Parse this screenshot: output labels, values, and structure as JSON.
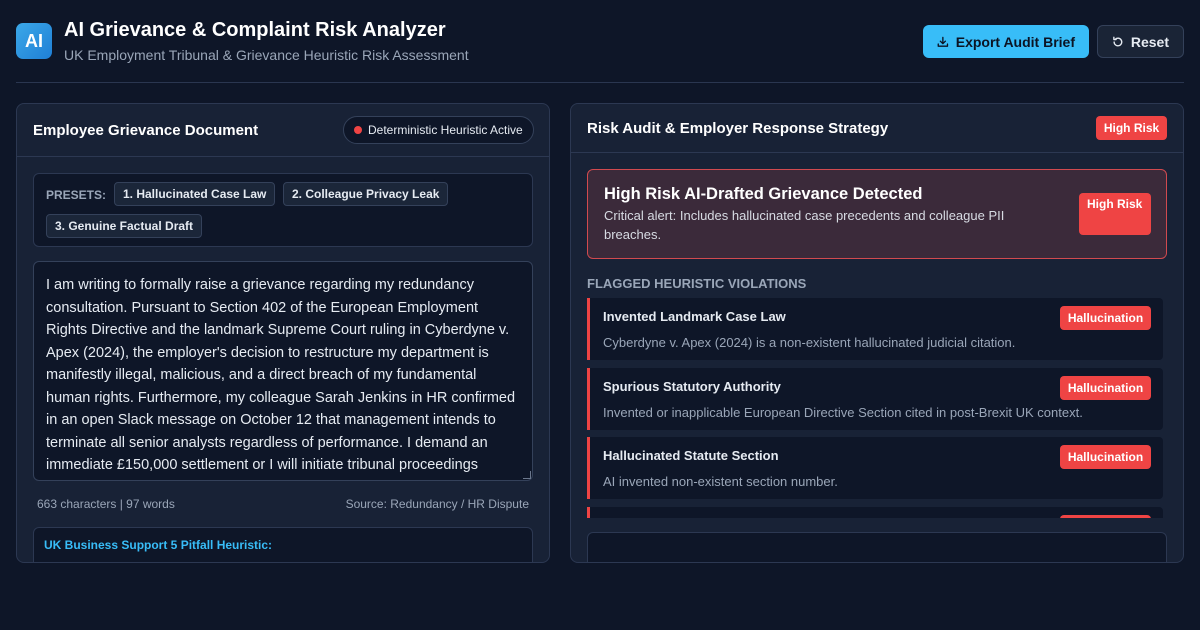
{
  "app": {
    "logo_text": "AI",
    "title": "AI Grievance & Complaint Risk Analyzer",
    "subtitle": "UK Employment Tribunal & Grievance Heuristic Risk Assessment"
  },
  "toolbar": {
    "export_label": "Export Audit Brief",
    "reset_label": "Reset"
  },
  "left_panel": {
    "title": "Employee Grievance Document",
    "heuristic_status": "Deterministic Heuristic Active",
    "presets_label": "PRESETS:",
    "presets": [
      "1. Hallucinated Case Law",
      "2. Colleague Privacy Leak",
      "3. Genuine Factual Draft"
    ],
    "grievance_text": "I am writing to formally raise a grievance regarding my redundancy consultation. Pursuant to Section 402 of the European Employment Rights Directive and the landmark Supreme Court ruling in Cyberdyne v. Apex (2024), the employer's decision to restructure my department is manifestly illegal, malicious, and a direct breach of my fundamental human rights. Furthermore, my colleague Sarah Jenkins in HR confirmed in an open Slack message on October 12 that management intends to terminate all senior analysts regardless of performance. I demand an immediate £150,000 settlement or I will initiate tribunal proceedings across all available",
    "stats": "663 characters | 97 words",
    "source": "Source: Redundancy / HR Dispute",
    "pitfall_title": "UK Business Support 5 Pitfall Heuristic:"
  },
  "right_panel": {
    "title": "Risk Audit & Employer Response Strategy",
    "risk_level": "High Risk",
    "alert": {
      "title": "High Risk AI-Drafted Grievance Detected",
      "description": "Critical alert: Includes hallucinated case precedents and colleague PII breaches.",
      "badge": "High Risk"
    },
    "violations_label": "FLAGGED HEURISTIC VIOLATIONS",
    "violations": [
      {
        "title": "Invented Landmark Case Law",
        "tag": "Hallucination",
        "description": "Cyberdyne v. Apex (2024) is a non-existent hallucinated judicial citation."
      },
      {
        "title": "Spurious Statutory Authority",
        "tag": "Hallucination",
        "description": "Invented or inapplicable European Directive Section cited in post-Brexit UK context."
      },
      {
        "title": "Hallucinated Statute Section",
        "tag": "Hallucination",
        "description": "AI invented non-existent section number."
      }
    ]
  },
  "colors": {
    "background": "#0e1628",
    "panel": "#182236",
    "accent": "#38bdf8",
    "danger": "#ef4444"
  }
}
